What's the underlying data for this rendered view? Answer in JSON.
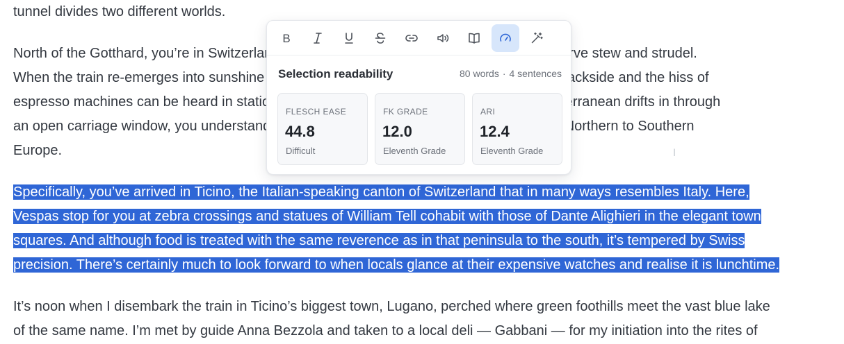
{
  "article": {
    "p0": [
      "tunnel divides two different worlds."
    ],
    "p1": [
      "North of the Gotthard, you’re in Switzerland, where bankers bustle to work and kitchens serve stew and strudel.",
      "When the train re-emerges into sunshine on the other side, there are sun-loving conifers trackside and the hiss of",
      "espresso machines can be heard in station cafés. And when the scent of the distant Mediterranean drifts in through",
      "an open carriage window, you understand that you have truly completed the journey from Northern to Southern",
      "Europe."
    ],
    "p2": [
      "Specifically, you’ve arrived in Ticino, the Italian-speaking canton of Switzerland that in many ways resembles Italy. Here,",
      "Vespas stop for you at zebra crossings and statues of William Tell cohabit with those of Dante Alighieri in the elegant town",
      "squares. And although food is treated with the same reverence as in that peninsula to the south, it’s tempered by Swiss",
      "precision. There’s certainly much to look forward to when locals glance at their expensive watches and realise it is lunchtime."
    ],
    "p3": [
      "It’s noon when I disembark the train in Ticino’s biggest town, Lugano, perched where green foothills meet the vast blue lake",
      "of the same name. I’m met by guide Anna Bezzola and taken to a local deli — Gabbani — for my initiation into the rites of"
    ]
  },
  "toolbar": {
    "buttons": [
      {
        "icon": "bold-icon",
        "glyph": "B"
      },
      {
        "icon": "italic-icon",
        "glyph": "I"
      },
      {
        "icon": "underline-icon",
        "glyph": "U"
      },
      {
        "icon": "strikethrough-icon",
        "glyph": "S"
      },
      {
        "icon": "link-icon"
      },
      {
        "icon": "speaker-icon"
      },
      {
        "icon": "book-icon"
      },
      {
        "icon": "gauge-icon",
        "active": true
      },
      {
        "icon": "magic-wand-icon"
      }
    ],
    "active_color": "#2f66d6",
    "active_bg": "#d7e6fb"
  },
  "readability": {
    "title": "Selection readability",
    "words": "80 words",
    "separator": "·",
    "sentences": "4 sentences",
    "cards": [
      {
        "label": "FLESCH EASE",
        "value": "44.8",
        "sub": "Difficult"
      },
      {
        "label": "FK GRADE",
        "value": "12.0",
        "sub": "Eleventh Grade"
      },
      {
        "label": "ARI",
        "value": "12.4",
        "sub": "Eleventh Grade"
      }
    ]
  },
  "colors": {
    "selection": "#2f66d6",
    "text": "#333840"
  }
}
